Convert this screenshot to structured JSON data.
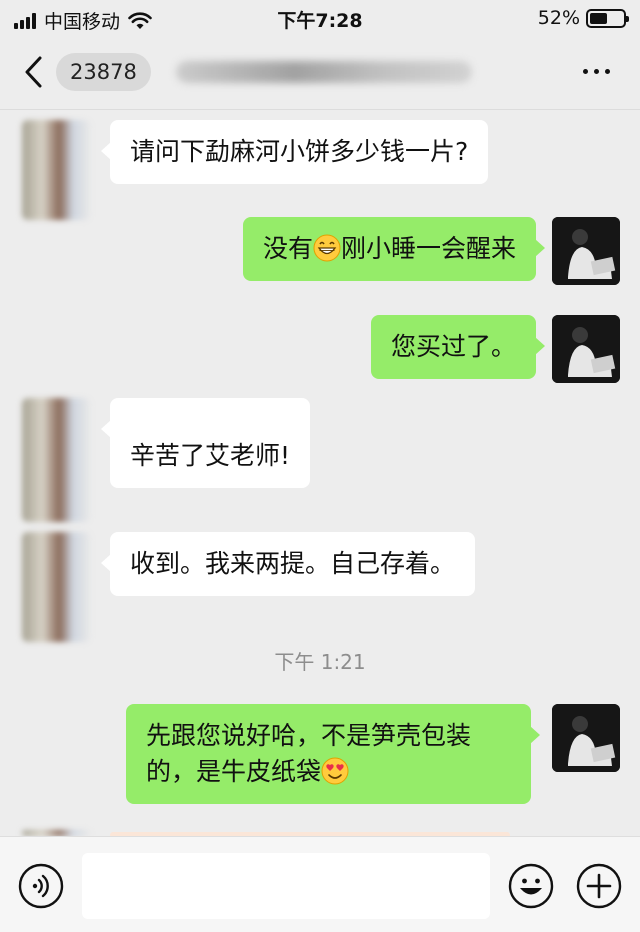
{
  "status_bar": {
    "carrier": "中国移动",
    "time": "下午7:28",
    "battery": "52%",
    "battery_level": 0.52
  },
  "nav": {
    "back_count": "23878"
  },
  "messages": [
    {
      "from": "other",
      "text": "请问下勐麻河小饼多少钱一片?"
    },
    {
      "from": "me",
      "text_before": "没有",
      "emoji": "grinning-face-emoji",
      "text_after": "刚小睡一会醒来"
    },
    {
      "from": "me",
      "text": "您买过了。"
    },
    {
      "from": "other",
      "text": "辛苦了艾老师!"
    },
    {
      "from": "other",
      "text": "收到。我来两提。自己存着。"
    },
    {
      "from": "time",
      "text": "下午 1:21"
    },
    {
      "from": "me",
      "line1": "先跟您说好哈，不是笋壳包装",
      "line2": "的，是牛皮纸袋",
      "emoji": "smiling-heart-eyes-emoji"
    }
  ],
  "input_bar": {
    "voice_icon": "voice-icon",
    "emoji_icon": "emoji-face-icon",
    "plus_icon": "plus-icon"
  },
  "colors": {
    "sent_bubble": "#95ec69",
    "received_bubble": "#ffffff",
    "background": "#ededed"
  }
}
